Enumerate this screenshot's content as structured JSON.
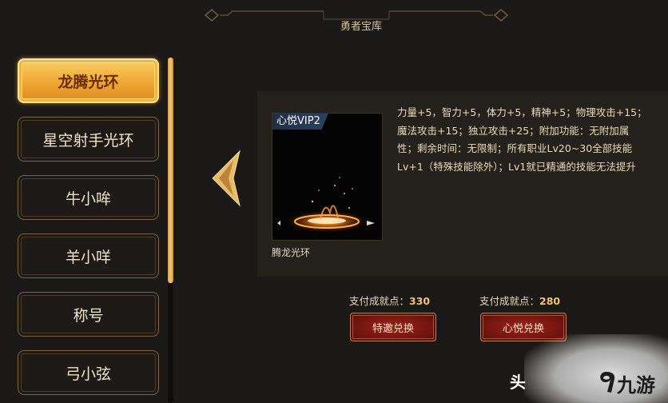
{
  "header": {
    "title": "勇者宝库"
  },
  "sidebar": {
    "items": [
      {
        "label": "龙腾光环",
        "active": true
      },
      {
        "label": "星空射手光环",
        "active": false
      },
      {
        "label": "牛小哞",
        "active": false
      },
      {
        "label": "羊小咩",
        "active": false
      },
      {
        "label": "称号",
        "active": false
      },
      {
        "label": "弓小弦",
        "active": false
      }
    ]
  },
  "item": {
    "vip_tag": "心悦VIP2",
    "name": "腾龙光环",
    "description": "力量+5，智力+5，体力+5，精神+5；物理攻击+15；魔法攻击+15；独立攻击+25；附加功能：无附加属性；剩余时间：无限制；所有职业Lv20~30全部技能Lv+1（特殊技能除外）；Lv1就已精通的技能无法提升",
    "art_icon": "halo-effect-image"
  },
  "offers": [
    {
      "price_label": "支付成就点：",
      "price": "330",
      "button": "特邀兑换"
    },
    {
      "price_label": "支付成就点：",
      "price": "280",
      "button": "心悦兑换"
    }
  ],
  "watermark": {
    "partial": "头",
    "brand": "九游",
    "logo_icon": "9game-logo-icon"
  },
  "colors": {
    "accent_gold": "#f0a733",
    "button_red": "#8a1c14",
    "panel_bg": "#24211d"
  }
}
